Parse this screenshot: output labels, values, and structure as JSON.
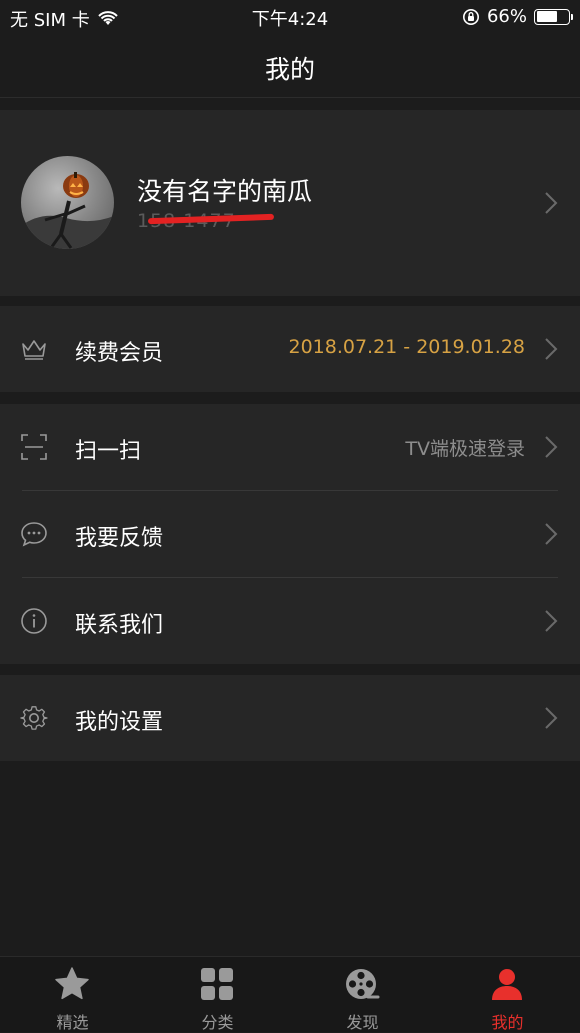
{
  "status_bar": {
    "carrier": "无 SIM 卡",
    "time": "下午4:24",
    "battery": "66%",
    "battery_level": 0.66
  },
  "header": {
    "title": "我的"
  },
  "profile": {
    "name": "没有名字的南瓜",
    "phone": "158 1477"
  },
  "membership": {
    "label": "续费会员",
    "value": "2018.07.21 - 2019.01.28",
    "icon": "crown-icon",
    "value_color": "#d7a244"
  },
  "menu": [
    {
      "label": "扫一扫",
      "value": "TV端极速登录",
      "icon": "scan-icon"
    },
    {
      "label": "我要反馈",
      "value": "",
      "icon": "chat-bubble-icon"
    },
    {
      "label": "联系我们",
      "value": "",
      "icon": "info-icon"
    }
  ],
  "settings": {
    "label": "我的设置",
    "icon": "gear-icon"
  },
  "tabs": [
    {
      "label": "精选",
      "icon": "star-icon",
      "active": false
    },
    {
      "label": "分类",
      "icon": "grid-icon",
      "active": false
    },
    {
      "label": "发现",
      "icon": "film-reel-icon",
      "active": false
    },
    {
      "label": "我的",
      "icon": "user-icon",
      "active": true
    }
  ],
  "colors": {
    "background": "#1c1c1c",
    "section": "#262626",
    "accent": "#e8302c",
    "gold": "#d7a244"
  }
}
